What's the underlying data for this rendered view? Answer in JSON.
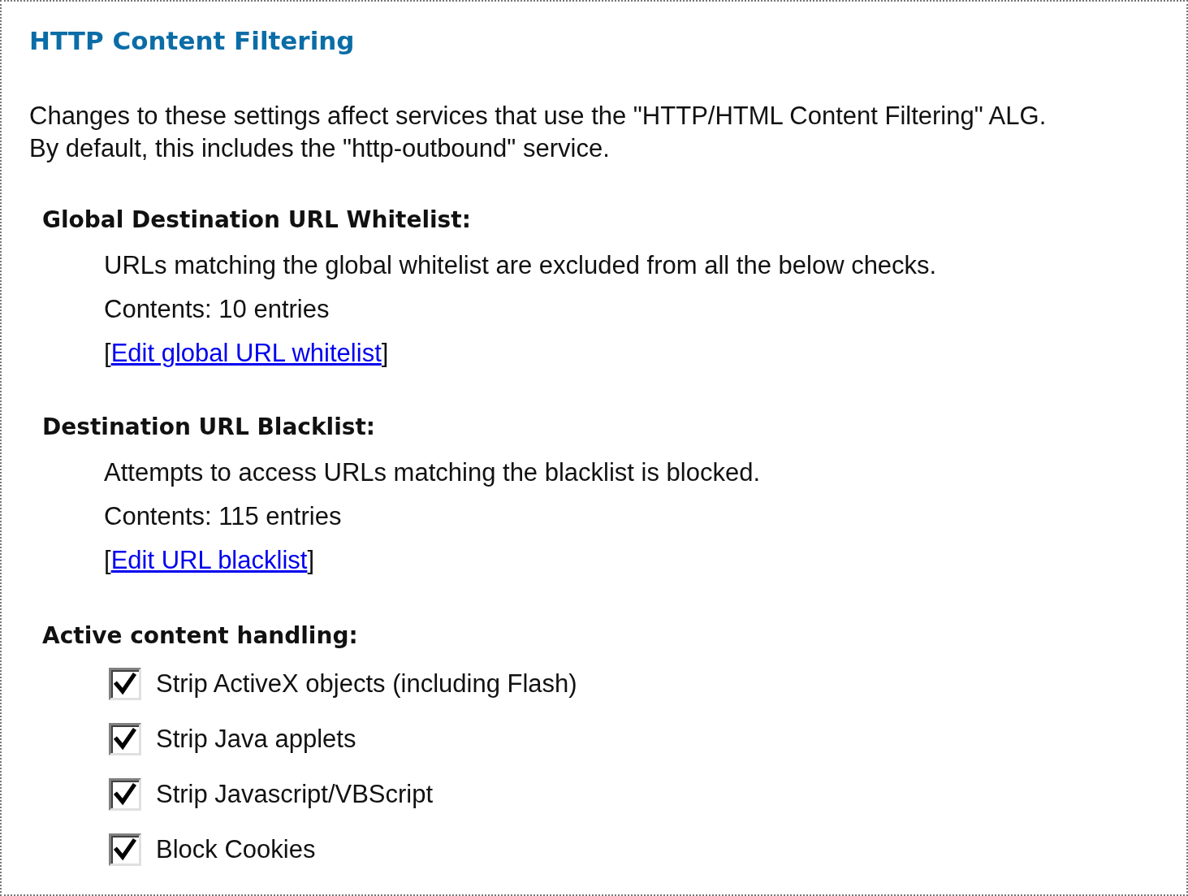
{
  "title": "HTTP Content Filtering",
  "description": [
    "Changes to these settings affect services that use the \"HTTP/HTML Content Filtering\" ALG.",
    "By default, this includes the \"http-outbound\" service."
  ],
  "sections": [
    {
      "heading": "Global Destination URL Whitelist:",
      "text": "URLs matching the global whitelist are excluded from all the below checks.",
      "contents": "Contents: 10 entries",
      "link": {
        "before": "[",
        "text": "Edit global URL whitelist",
        "after": "]"
      }
    },
    {
      "heading": "Destination URL Blacklist:",
      "text": "Attempts to access URLs matching the blacklist is blocked.",
      "contents": "Contents: 115 entries",
      "link": {
        "before": "[",
        "text": "Edit URL blacklist",
        "after": "]"
      }
    }
  ],
  "active_content": {
    "heading": "Active content handling:",
    "options": [
      {
        "label": "Strip ActiveX objects (including Flash)",
        "checked": true
      },
      {
        "label": "Strip Java applets",
        "checked": true
      },
      {
        "label": "Strip Javascript/VBScript",
        "checked": true
      },
      {
        "label": "Block Cookies",
        "checked": true
      }
    ]
  }
}
